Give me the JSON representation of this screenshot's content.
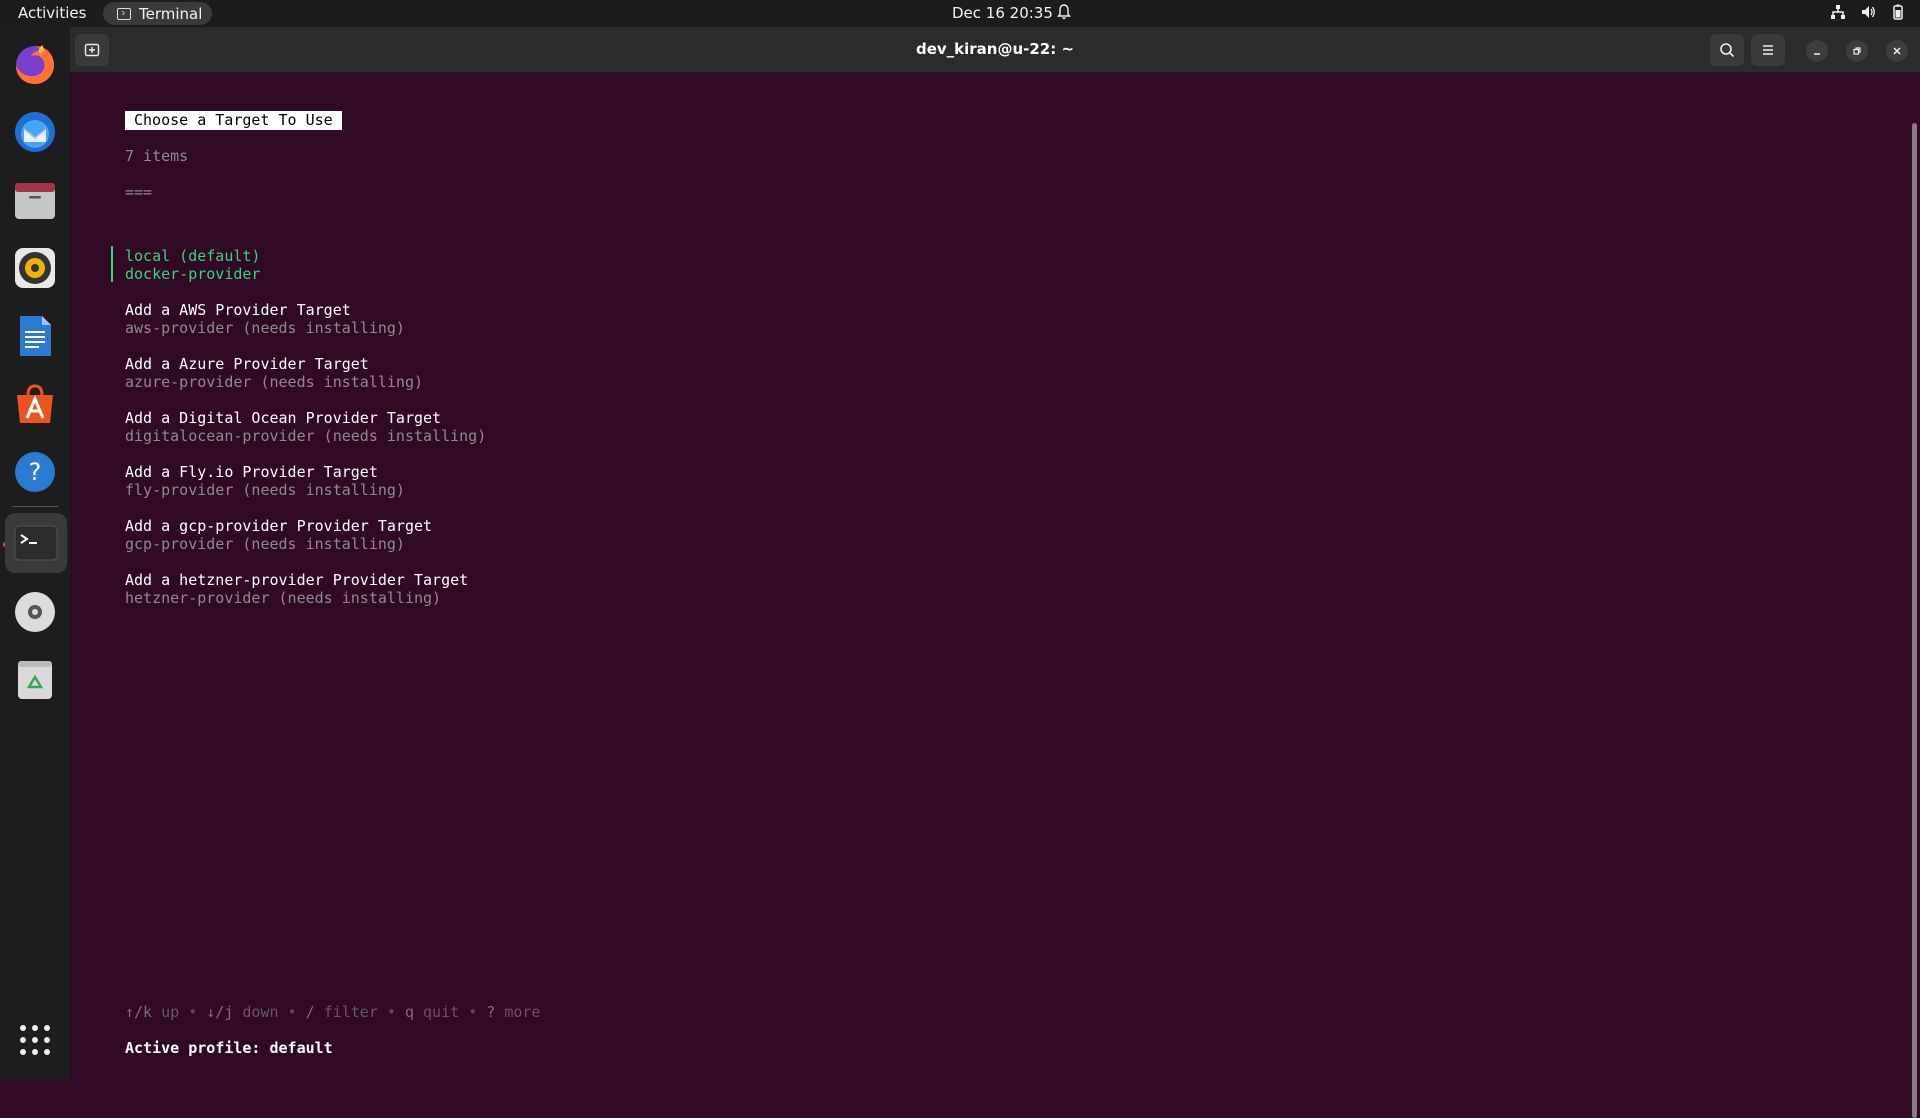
{
  "topbar": {
    "activities": "Activities",
    "app_name": "Terminal",
    "clock": "Dec 16  20:35"
  },
  "dock": {
    "items": [
      "firefox-icon",
      "thunderbird-icon",
      "files-icon",
      "rhythmbox-icon",
      "libreoffice-writer-icon",
      "app-center-icon",
      "help-icon",
      "terminal-icon",
      "disc-icon",
      "trash-icon",
      "app-grid-icon"
    ]
  },
  "window": {
    "title": "dev_kiran@u-22: ~"
  },
  "terminal": {
    "list_title": "Choose a Target To Use",
    "item_count": "7 items",
    "separator": "===",
    "items": [
      {
        "title": "local (default)",
        "desc": "docker-provider",
        "selected": true
      },
      {
        "title": "Add a AWS Provider Target",
        "desc": "aws-provider (needs installing)"
      },
      {
        "title": "Add a Azure Provider Target",
        "desc": "azure-provider (needs installing)"
      },
      {
        "title": "Add a Digital Ocean Provider Target",
        "desc": "digitalocean-provider (needs installing)"
      },
      {
        "title": "Add a Fly.io Provider Target",
        "desc": "fly-provider (needs installing)"
      },
      {
        "title": "Add a gcp-provider Provider Target",
        "desc": "gcp-provider (needs installing)"
      },
      {
        "title": "Add a hetzner-provider Provider Target",
        "desc": "hetzner-provider (needs installing)"
      }
    ],
    "help": {
      "up_key": "↑/k",
      "up": "up",
      "down_key": "↓/j",
      "down": "down",
      "filter_key": "/",
      "filter": "filter",
      "quit_key": "q",
      "quit": "quit",
      "more_key": "?",
      "more": "more",
      "bullet": "•"
    },
    "active_profile": "Active profile: default"
  },
  "colors": {
    "terminal_bg": "#300a24",
    "selected": "#3fd07c",
    "headerbar": "#2b2b2b"
  }
}
